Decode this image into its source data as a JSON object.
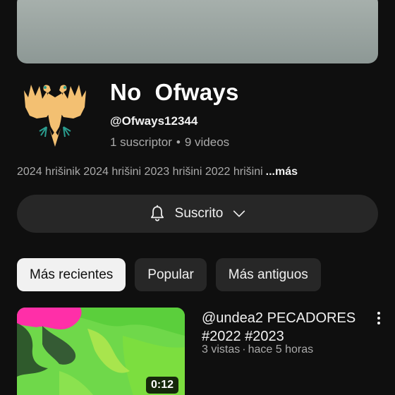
{
  "channel": {
    "name": "No  Ofways",
    "handle": "@Ofways12344",
    "subscribers": "1 suscriptor",
    "videos": "9 videos",
    "stats_separator": "•",
    "description": "2024 hrišinik 2024 hrišini 2023 hrišini 2022 hrišini",
    "more_label": "...más"
  },
  "subscribe": {
    "label": "Suscrito",
    "icons": [
      "bell-icon",
      "chevron-down-icon"
    ]
  },
  "chips": [
    {
      "label": "Más recientes",
      "active": true
    },
    {
      "label": "Popular",
      "active": false
    },
    {
      "label": "Más antiguos",
      "active": false
    }
  ],
  "videos": [
    {
      "title": "@undea2 PECADORES #2022 #2023",
      "views": "3 vistas",
      "separator": "·",
      "age": "hace 5 horas",
      "duration": "0:12"
    }
  ],
  "colors": {
    "background": "#0f0f0f",
    "button_bg": "#272727",
    "chip_active_bg": "#f1f1f1",
    "muted_text": "#aaaaaa",
    "banner": "#a9b2ae",
    "eagle_gold": "#f3c072"
  }
}
